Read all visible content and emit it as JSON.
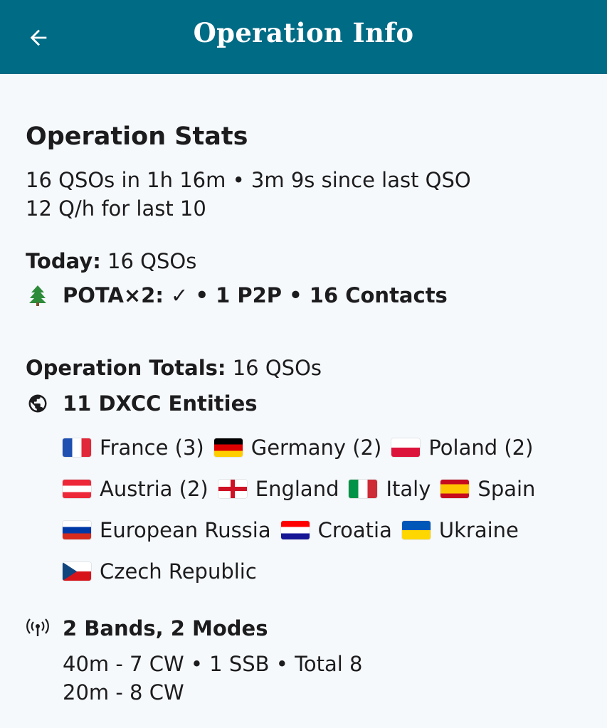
{
  "appbar": {
    "title": "Operation Info",
    "back_icon": "arrow-back-icon"
  },
  "stats": {
    "heading": "Operation Stats",
    "line1": "16 QSOs in 1h 16m • 3m 9s since last QSO",
    "line2": "12 Q/h for last 10"
  },
  "today": {
    "label": "Today:",
    "value": " 16 QSOs",
    "pota_icon": "tree-icon",
    "pota_text": "POTA×2: ✓ • 1 P2P • 16 Contacts"
  },
  "totals": {
    "label": "Operation Totals:",
    "value": " 16 QSOs",
    "dxcc_icon": "globe-icon",
    "dxcc_text": "11 DXCC Entities",
    "countries": [
      {
        "name": "France (3)",
        "flag": "fr"
      },
      {
        "name": "Germany (2)",
        "flag": "de"
      },
      {
        "name": "Poland (2)",
        "flag": "pl"
      },
      {
        "name": "Austria (2)",
        "flag": "at"
      },
      {
        "name": "England",
        "flag": "en"
      },
      {
        "name": "Italy",
        "flag": "it"
      },
      {
        "name": "Spain",
        "flag": "es"
      },
      {
        "name": "European Russia",
        "flag": "ru"
      },
      {
        "name": "Croatia",
        "flag": "hr"
      },
      {
        "name": "Ukraine",
        "flag": "ua"
      },
      {
        "name": "Czech Republic",
        "flag": "cz"
      }
    ]
  },
  "bands": {
    "icon": "antenna-icon",
    "heading": "2 Bands, 2 Modes",
    "line1": "40m -  7 CW • 1 SSB • Total 8",
    "line2": "20m -  8 CW"
  },
  "colors": {
    "appbar": "#006b85",
    "background": "#f6f9fb",
    "tree": "#2e8b3a"
  }
}
